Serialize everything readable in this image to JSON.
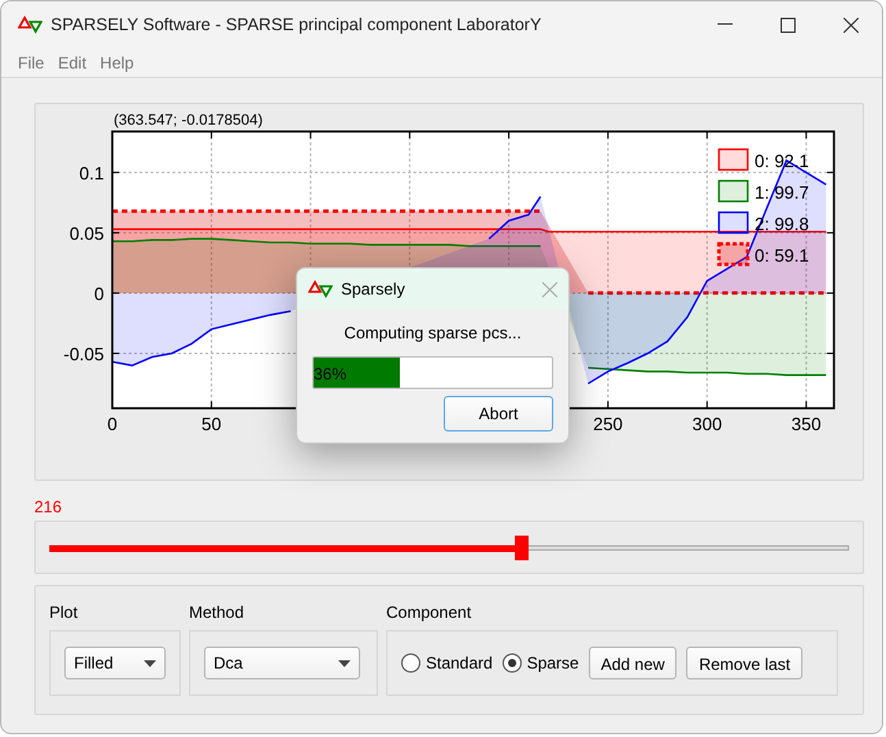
{
  "window": {
    "title": "SPARSELY Software - SPARSE principal component LaboratorY"
  },
  "menu": [
    "File",
    "Edit",
    "Help"
  ],
  "plot": {
    "coordinates": "(363.547; -0.0178504)",
    "chart_data": {
      "type": "area",
      "grid": true,
      "legend": true,
      "xlim": [
        0,
        364
      ],
      "ylim": [
        -0.0955,
        0.134
      ],
      "xticks": [
        0,
        50,
        250,
        300,
        350
      ],
      "yticks": [
        -0.05,
        0,
        0.05,
        0.1
      ],
      "x": [
        0,
        10,
        20,
        30,
        40,
        50,
        60,
        70,
        80,
        90,
        100,
        110,
        120,
        130,
        140,
        150,
        160,
        170,
        180,
        190,
        200,
        210,
        216,
        220,
        230,
        240,
        250,
        260,
        270,
        280,
        290,
        300,
        310,
        320,
        330,
        340,
        350,
        360
      ],
      "series": [
        {
          "name": "0: 92.1",
          "color": "#ff0000",
          "line_style": "solid",
          "values": [
            0.053,
            0.053,
            0.053,
            0.053,
            0.053,
            0.053,
            0.053,
            0.053,
            0.053,
            0.053,
            0.053,
            0.053,
            0.053,
            0.053,
            0.053,
            0.053,
            0.053,
            0.053,
            0.053,
            0.053,
            0.053,
            0.053,
            0.053,
            0.051,
            0.051,
            0.051,
            0.051,
            0.051,
            0.051,
            0.051,
            0.051,
            0.051,
            0.051,
            0.051,
            0.051,
            0.051,
            0.051,
            0.051
          ]
        },
        {
          "name": "1: 99.7",
          "color": "#008000",
          "line_style": "solid",
          "values": [
            0.043,
            0.043,
            0.044,
            0.044,
            0.045,
            0.045,
            0.044,
            0.043,
            0.042,
            0.042,
            0.041,
            0.041,
            0.041,
            0.04,
            0.04,
            0.04,
            0.04,
            0.04,
            0.039,
            0.039,
            0.039,
            0.039,
            0.039,
            null,
            null,
            -0.062,
            -0.063,
            -0.064,
            -0.065,
            -0.065,
            -0.066,
            -0.066,
            -0.066,
            -0.067,
            -0.067,
            -0.068,
            -0.068,
            -0.068
          ]
        },
        {
          "name": "2: 99.8",
          "color": "#0000ff",
          "line_style": "solid",
          "values": [
            -0.057,
            -0.06,
            -0.053,
            -0.05,
            -0.042,
            -0.03,
            -0.026,
            -0.022,
            -0.018,
            -0.015,
            null,
            null,
            null,
            null,
            null,
            null,
            null,
            null,
            null,
            0.045,
            0.06,
            0.065,
            0.08,
            null,
            null,
            -0.075,
            -0.065,
            -0.058,
            -0.05,
            -0.04,
            -0.02,
            0.01,
            0.02,
            0.03,
            0.07,
            0.11,
            0.1,
            0.09
          ]
        },
        {
          "name": "0: 59.1",
          "color": "#ff0000",
          "line_style": "dashed",
          "values": [
            0.068,
            0.068,
            0.068,
            0.068,
            0.068,
            0.068,
            0.068,
            0.068,
            0.068,
            0.068,
            0.068,
            0.068,
            0.068,
            0.068,
            0.068,
            0.068,
            0.068,
            0.068,
            0.068,
            0.068,
            0.068,
            0.068,
            0.068,
            null,
            null,
            0,
            0,
            0,
            0,
            0,
            0,
            0,
            0,
            0,
            0,
            0,
            0,
            0
          ]
        }
      ]
    }
  },
  "dialog": {
    "title": "Sparsely",
    "message": "Computing sparse pcs...",
    "progress": {
      "level": 0.36,
      "label": "36%"
    },
    "button": "Abort"
  },
  "slider": {
    "value": "216",
    "level": 0.59
  },
  "controls": {
    "plot": {
      "label": "Plot",
      "value": "Filled"
    },
    "method": {
      "label": "Method",
      "value": "Dca"
    },
    "component": {
      "label": "Component",
      "options": [
        {
          "label": "Standard",
          "selected": false
        },
        {
          "label": "Sparse",
          "selected": true
        }
      ],
      "buttons": [
        "Add new",
        "Remove last"
      ]
    }
  }
}
